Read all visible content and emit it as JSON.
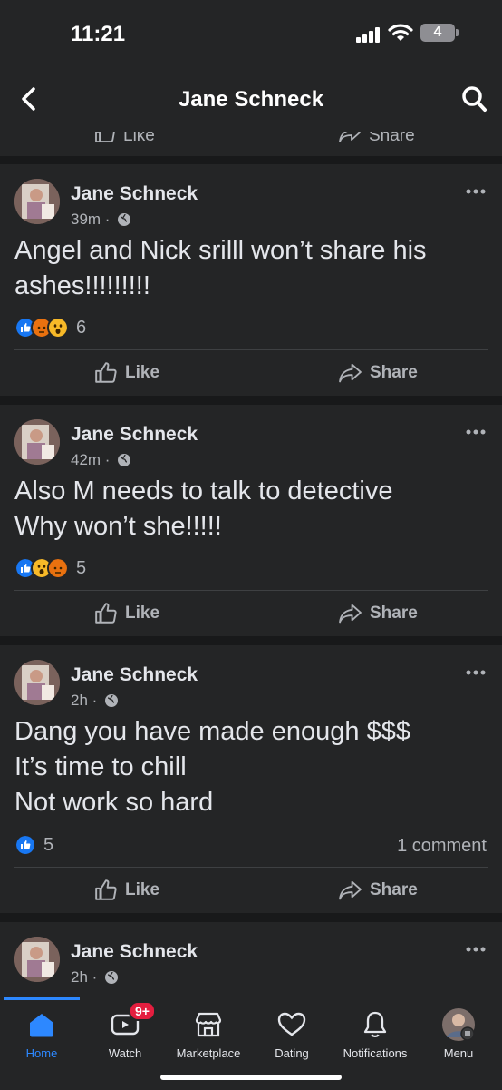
{
  "status_bar": {
    "time": "11:21",
    "battery": "4"
  },
  "header": {
    "title": "Jane Schneck"
  },
  "actions": {
    "like": "Like",
    "share": "Share"
  },
  "posts": [
    {
      "author": "Jane Schneck",
      "time": "39m · ",
      "text": "Angel and Nick srilll won’t share his ashes!!!!!!!!!",
      "reaction_count": "6",
      "comments": ""
    },
    {
      "author": "Jane Schneck",
      "time": "42m · ",
      "text": "Also M needs to talk to detective\nWhy won’t she!!!!!",
      "reaction_count": "5",
      "comments": ""
    },
    {
      "author": "Jane Schneck",
      "time": "2h · ",
      "text": "Dang you have made enough $$$\nIt’s time to chill\nNot work so hard",
      "reaction_count": "5",
      "comments": "1 comment"
    },
    {
      "author": "Jane Schneck",
      "time": "2h · ",
      "text": "",
      "reaction_count": "",
      "comments": ""
    }
  ],
  "tabs": [
    {
      "label": "Home",
      "icon": "home-icon"
    },
    {
      "label": "Watch",
      "icon": "watch-icon",
      "badge": "9+"
    },
    {
      "label": "Marketplace",
      "icon": "marketplace-icon"
    },
    {
      "label": "Dating",
      "icon": "dating-icon"
    },
    {
      "label": "Notifications",
      "icon": "bell-icon"
    },
    {
      "label": "Menu",
      "icon": "profile-avatar"
    }
  ],
  "colors": {
    "background": "#18191a",
    "card": "#242526",
    "accent": "#2d88ff",
    "like_blue": "#1877f2",
    "angry_orange": "#e9710f",
    "wow_yellow": "#f7b928",
    "badge_red": "#e41e3f"
  }
}
